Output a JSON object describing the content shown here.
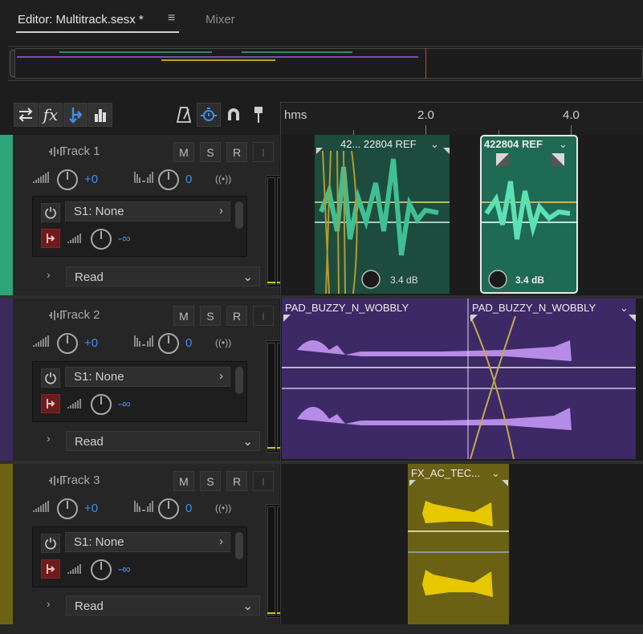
{
  "tabs": {
    "editor_label": "Editor: Multitrack.sesx *",
    "mixer_label": "Mixer",
    "menu_glyph": "≡"
  },
  "toolbar": {
    "icons": [
      "swap-icon",
      "fx-icon",
      "routing-icon",
      "meters-icon",
      "metronome-icon",
      "time-stretch-icon",
      "snap-icon",
      "marker-pin-icon"
    ],
    "fx_glyph": "fx"
  },
  "ruler": {
    "unit_label": "hms",
    "labels": [
      "2.0",
      "4.0"
    ]
  },
  "tracks": [
    {
      "name": "Track 1",
      "color": "#2fa37a",
      "volume": "+0",
      "pan": "0",
      "fx_slot": "S1: None",
      "send_level": "-∞",
      "automation": "Read"
    },
    {
      "name": "Track 2",
      "color": "#3b2a5c",
      "volume": "+0",
      "pan": "0",
      "fx_slot": "S1: None",
      "send_level": "-∞",
      "automation": "Read"
    },
    {
      "name": "Track 3",
      "color": "#6c6413",
      "volume": "+0",
      "pan": "0",
      "fx_slot": "S1: None",
      "send_level": "-∞",
      "automation": "Read"
    }
  ],
  "buttons": {
    "mute": "M",
    "solo": "S",
    "record": "R",
    "input": "I"
  },
  "clips": {
    "t1a_title": "42... 22804 REF",
    "t1a_gain": "3.4 dB",
    "t1b_title": "422804 REF",
    "t1b_gain": "3.4 dB",
    "t2a_title": "PAD_BUZZY_N_WOBBLY",
    "t2b_title": "PAD_BUZZY_N_WOBBLY",
    "t3_title": "FX_AC_TEC..."
  },
  "colors": {
    "accent_blue": "#3d8fe8",
    "teal_clip": "#1f5a47",
    "purple_clip": "#4a2f78",
    "yellow_clip": "#6f6513"
  }
}
